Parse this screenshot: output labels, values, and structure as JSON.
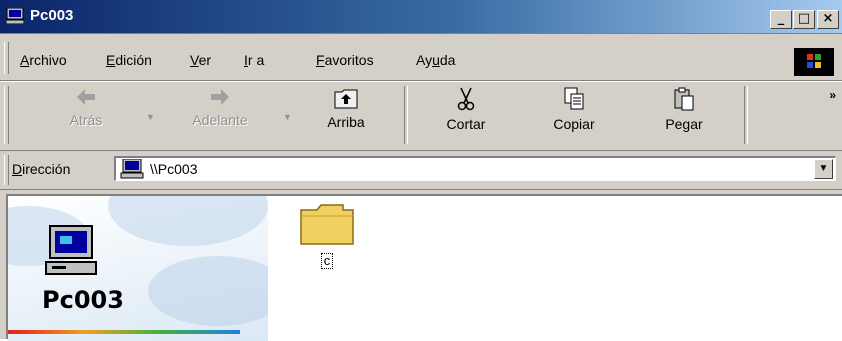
{
  "window": {
    "title": "Pc003",
    "controls": {
      "minimize": "_",
      "maximize": "□",
      "close": "×"
    }
  },
  "menu": {
    "items": [
      {
        "label": "Archivo",
        "accel": "A",
        "rest": "rchivo"
      },
      {
        "label": "Edición",
        "accel": "E",
        "rest": "dición"
      },
      {
        "label": "Ver",
        "accel": "V",
        "rest": "er"
      },
      {
        "label": "Ir a",
        "accel": "I",
        "rest": "r a"
      },
      {
        "label": "Favoritos",
        "accel": "F",
        "rest": "avoritos"
      },
      {
        "label": "Ayuda",
        "pre": "Ay",
        "accel": "u",
        "rest": "da"
      }
    ]
  },
  "toolbar": {
    "back": "Atrás",
    "forward": "Adelante",
    "up": "Arriba",
    "cut": "Cortar",
    "copy": "Copiar",
    "paste": "Pegar",
    "more": "»"
  },
  "address": {
    "label_accel": "D",
    "label_rest": "irección",
    "value": "\\\\Pc003",
    "dropdown": "▼"
  },
  "content": {
    "pane_title": "Pc003",
    "items": [
      {
        "name": "c",
        "type": "folder"
      }
    ]
  },
  "colors": {
    "titlebar_start": "#0a246a",
    "titlebar_end": "#a6caf0",
    "chrome": "#d4d0c8",
    "folder": "#f0d060"
  },
  "icons": {
    "title": "computer-icon",
    "address": "computer-icon",
    "pane": "computer-icon",
    "item": "folder-icon"
  }
}
